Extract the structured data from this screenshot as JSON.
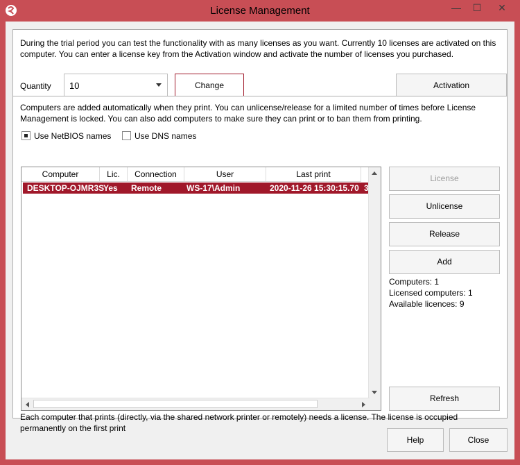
{
  "window": {
    "title": "License Management",
    "controls": {
      "minimize": "—",
      "maximize": "☐",
      "close": "✕"
    },
    "accent_color": "#c84e55"
  },
  "top": {
    "description": "During the trial period you can test the functionality with as many licenses as you want. Currently 10 licenses are activated on this computer. You can enter a license key from the Activation window and activate the number of licenses you purchased.",
    "quantity_label": "Quantity",
    "quantity_value": "10",
    "change_label": "Change",
    "activation_label": "Activation"
  },
  "bottom": {
    "description": "Computers are added automatically when they print. You can unlicense/release for a limited number of times before License Management is locked. You can also add computers to make sure they can print or to ban them from printing.",
    "netbios_label": "Use NetBIOS names",
    "netbios_checked": true,
    "dns_label": "Use DNS names",
    "dns_checked": false,
    "table": {
      "columns": [
        "Computer",
        "Lic.",
        "Connection",
        "User",
        "Last print"
      ],
      "rows": [
        {
          "computer": "DESKTOP-OJMR3S",
          "lic": "Yes",
          "connection": "Remote",
          "user": "WS-17\\Admin",
          "last_print": "2020-11-26 15:30:15.70",
          "extra": "3"
        }
      ],
      "selected_row_color": "#a0182a"
    },
    "side_buttons": {
      "license": "License",
      "unlicense": "Unlicense",
      "release": "Release",
      "add": "Add",
      "refresh": "Refresh"
    },
    "stats": {
      "computers": "Computers: 1",
      "licensed": "Licensed computers: 1",
      "available": "Available licences:  9"
    },
    "footer_note": "Each computer that prints (directly, via the shared network printer or remotely) needs a license. The license is occupied permanently on the first print"
  },
  "footer": {
    "help_label": "Help",
    "close_label": "Close"
  }
}
